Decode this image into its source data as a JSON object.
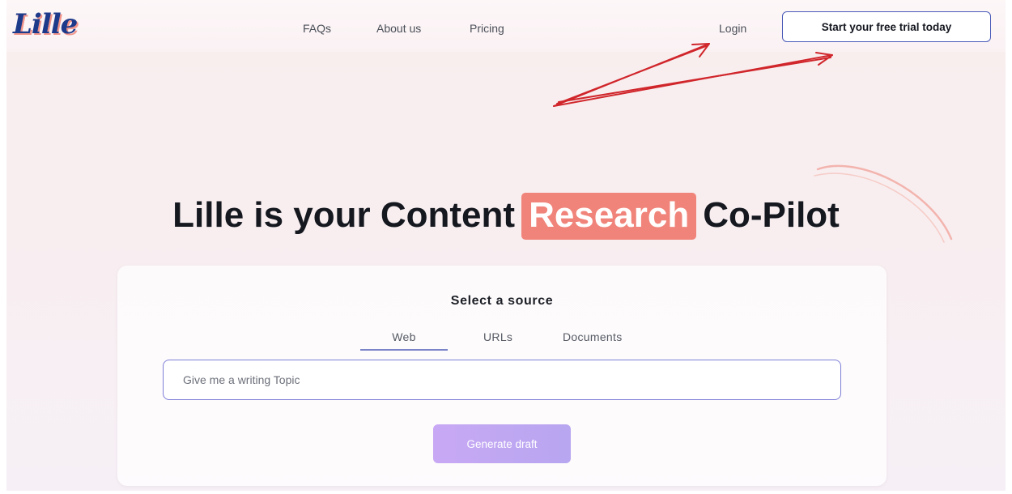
{
  "nav": {
    "logo": "Lille",
    "links": [
      "FAQs",
      "About us",
      "Pricing"
    ],
    "login": "Login",
    "trial_button": "Start your free trial today"
  },
  "hero": {
    "title_before": "Lille is your Content",
    "title_highlight": "Research",
    "title_after": "Co-Pilot"
  },
  "card": {
    "title": "Select a source",
    "tabs": [
      "Web",
      "URLs",
      "Documents"
    ],
    "selected_tab": "Web",
    "input_placeholder": "Give me a writing Topic",
    "input_value": "",
    "generate_button": "Generate draft"
  },
  "colors": {
    "brand_blue": "#1e3a8a",
    "highlight": "#f0847a",
    "button_purple": "#c8a8f4",
    "annotation_arrow": "#d0262b"
  },
  "icons": [
    "annotation-arrow-icon",
    "decorative-swirl-icon"
  ]
}
